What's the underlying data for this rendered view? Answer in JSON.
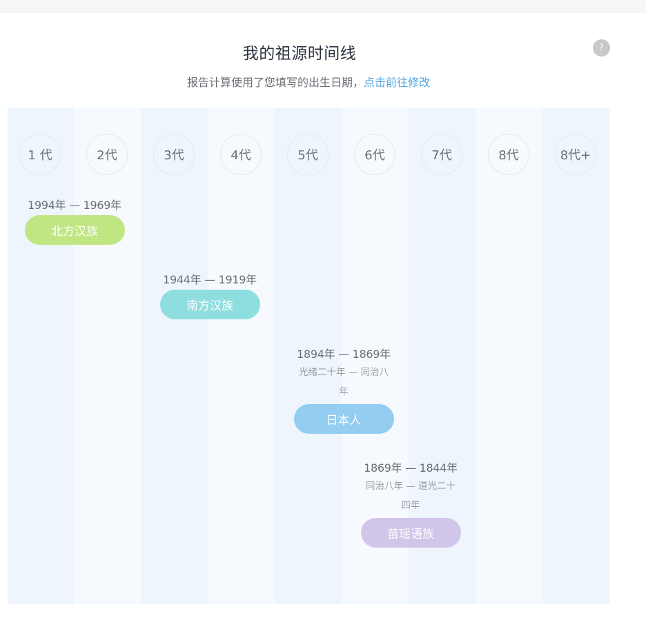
{
  "header": {
    "title": "我的祖源时间线",
    "subtitle_text": "报告计算使用了您填写的出生日期，",
    "subtitle_link": "点击前往修改",
    "help_icon_glyph": "?"
  },
  "generations": [
    "1 代",
    "2代",
    "3代",
    "4代",
    "5代",
    "6代",
    "7代",
    "8代",
    "8代+"
  ],
  "entries": [
    {
      "years": "1994年 — 1969年",
      "label": "北方汉族",
      "color": "#bfe682"
    },
    {
      "years": "1944年 — 1919年",
      "label": "南方汉族",
      "color": "#8fdedf"
    },
    {
      "years": "1894年 — 1869年",
      "era": "光绪二十年 — 同治八年",
      "label": "日本人",
      "color": "#93cdf1"
    },
    {
      "years": "1869年 — 1844年",
      "era": "同治八年 — 道光二十四年",
      "label": "苗瑶语族",
      "color": "#d2c5ea"
    }
  ]
}
